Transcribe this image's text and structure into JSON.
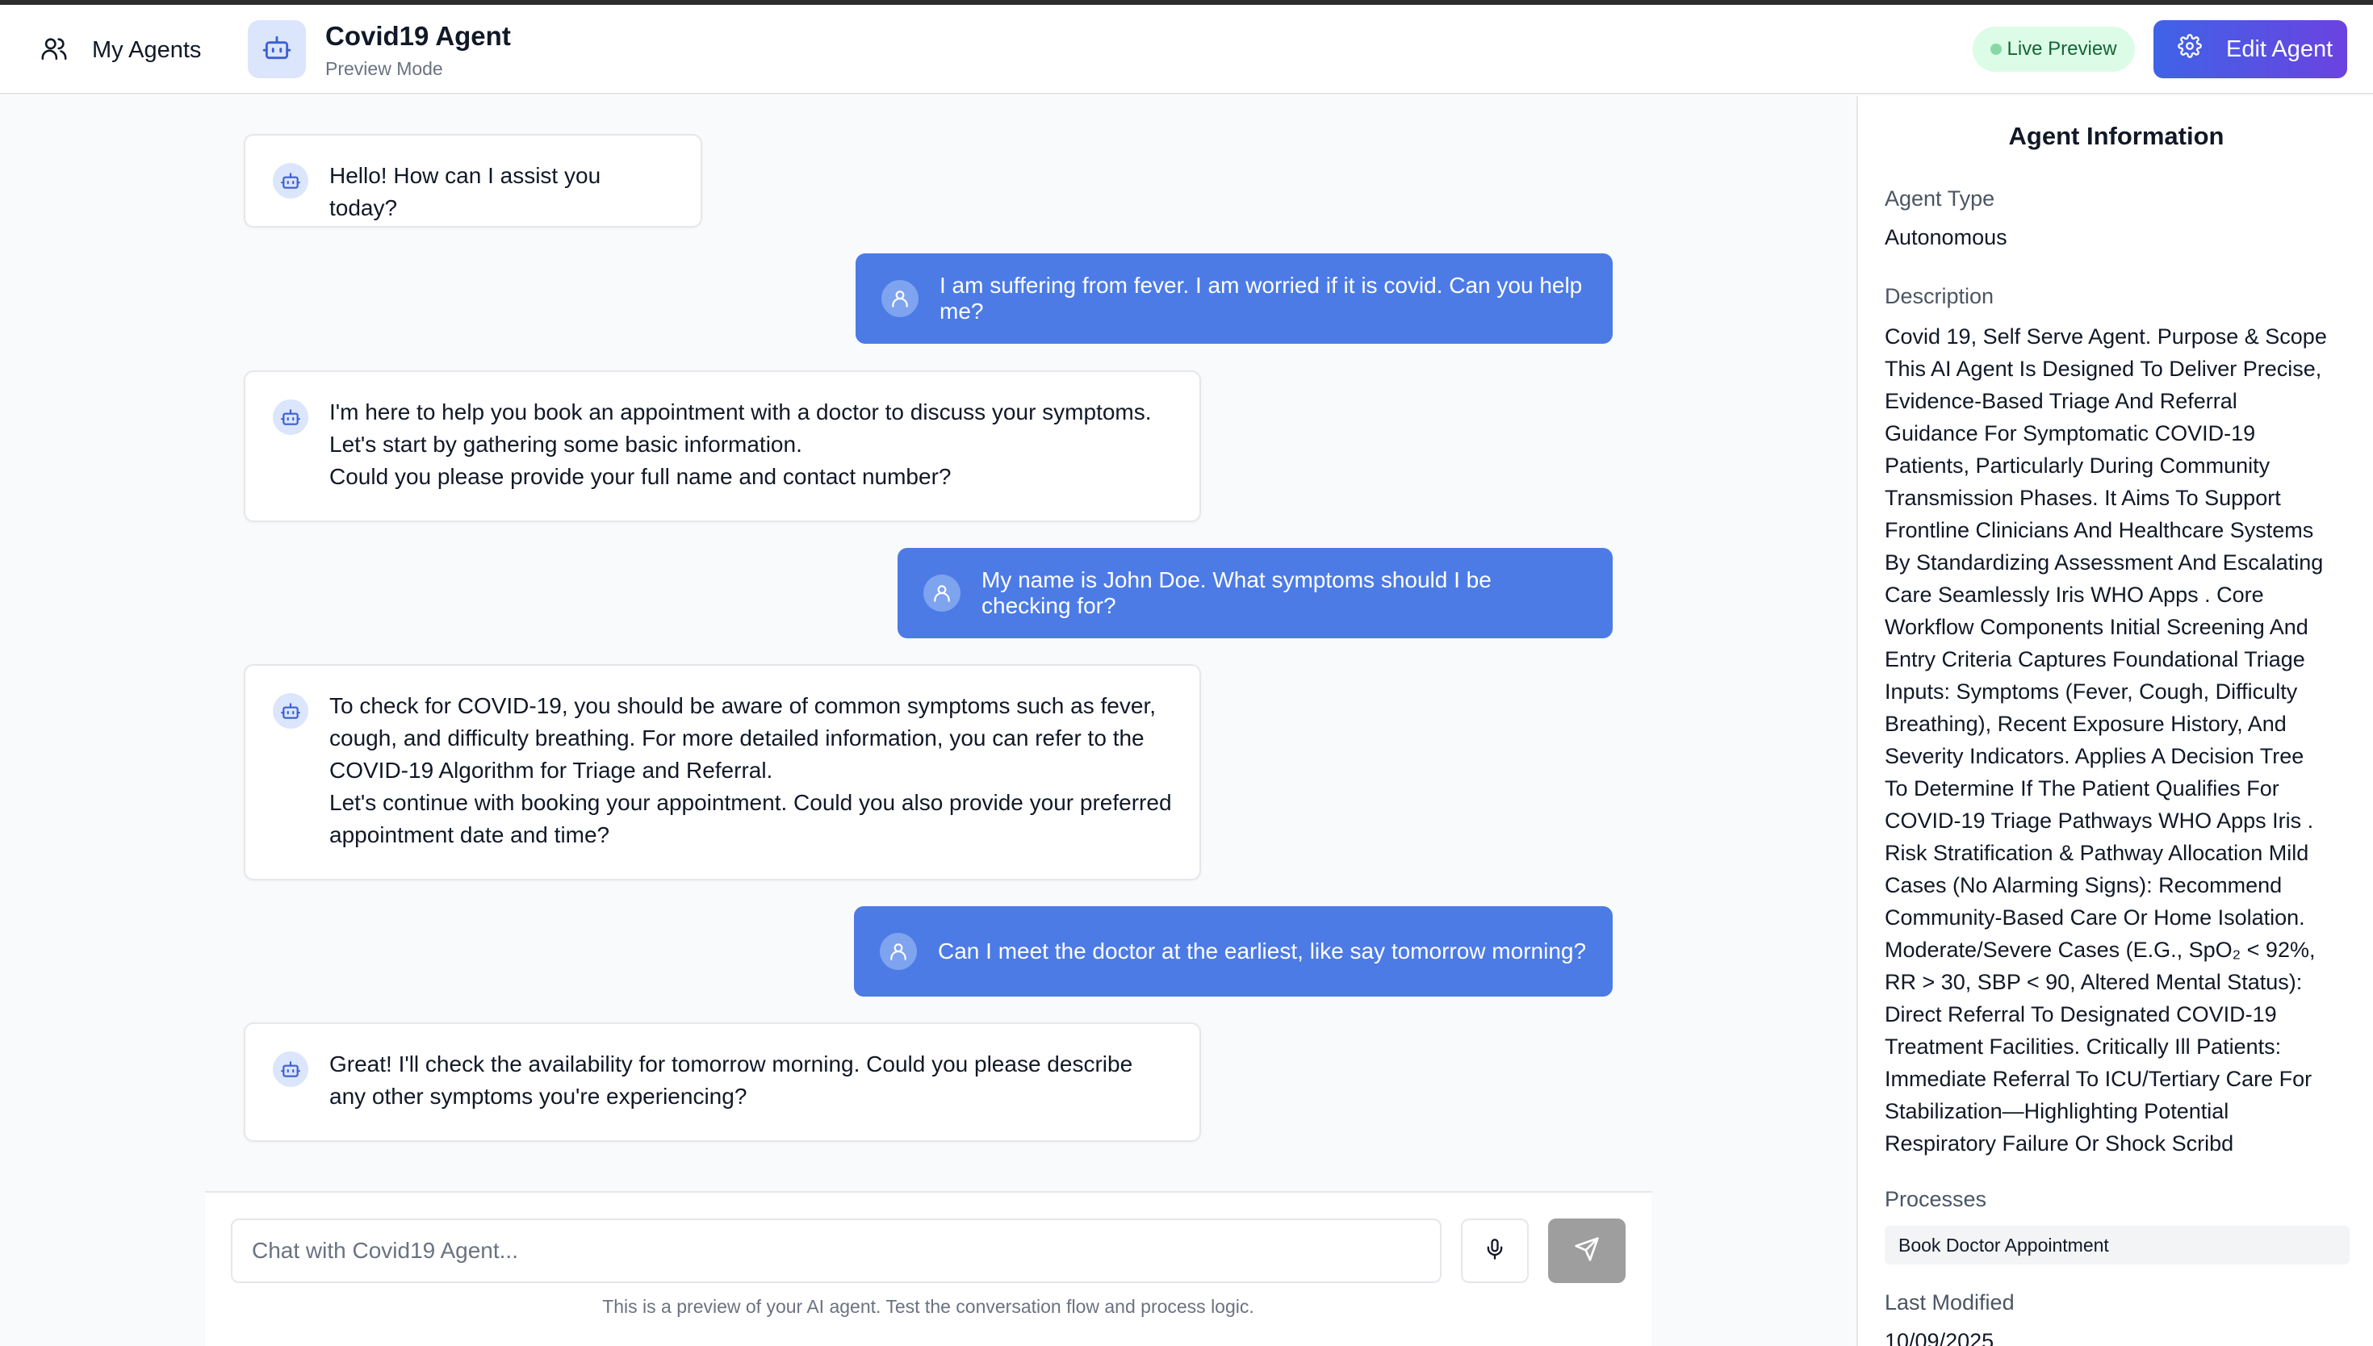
{
  "header": {
    "my_agents_label": "My Agents",
    "agent_name": "Covid19 Agent",
    "mode": "Preview Mode",
    "live_preview": "Live Preview",
    "edit_agent": "Edit Agent"
  },
  "messages": [
    {
      "role": "bot",
      "text": "Hello! How can I assist you today?"
    },
    {
      "role": "user",
      "text": "I am suffering from fever. I am worried if it is covid. Can you help me?"
    },
    {
      "role": "bot",
      "lines": [
        "I'm here to help you book an appointment with a doctor to discuss your symptoms.",
        "Let's start by gathering some basic information.",
        "Could you please provide your full name and contact number?"
      ]
    },
    {
      "role": "user",
      "text": "My name is John Doe. What symptoms should I be checking for?"
    },
    {
      "role": "bot",
      "lines": [
        "To check for COVID-19, you should be aware of common symptoms such as fever,",
        "cough, and difficulty breathing. For more detailed information, you can refer to the",
        "COVID-19 Algorithm for Triage and Referral.",
        "Let's continue with booking your appointment. Could you also provide your preferred",
        "appointment date and time?"
      ]
    },
    {
      "role": "user",
      "text": "Can I meet the doctor at the earliest, like say tomorrow morning?"
    },
    {
      "role": "bot",
      "lines": [
        "Great! I'll check the availability for tomorrow morning. Could you please describe",
        "any other symptoms you're experiencing?"
      ]
    }
  ],
  "chat_input": {
    "placeholder": "Chat with Covid19 Agent...",
    "note": "This is a preview of your AI agent. Test the conversation flow and process logic."
  },
  "panel": {
    "title": "Agent Information",
    "agent_type_label": "Agent Type",
    "agent_type": "Autonomous",
    "description_label": "Description",
    "description_lines": [
      "Covid 19, Self Serve Agent. Purpose & Scope",
      "This AI Agent Is Designed To Deliver Precise,",
      "Evidence-Based Triage And Referral",
      "Guidance For Symptomatic COVID-19",
      "Patients, Particularly During Community",
      "Transmission Phases. It Aims To Support",
      "Frontline Clinicians And Healthcare Systems",
      "By Standardizing Assessment And Escalating",
      "Care Seamlessly Iris WHO Apps . Core",
      "Workflow Components Initial Screening And",
      "Entry Criteria Captures Foundational Triage",
      "Inputs: Symptoms (Fever, Cough, Difficulty",
      "Breathing), Recent Exposure History, And",
      "Severity Indicators. Applies A Decision Tree",
      "To Determine If The Patient Qualifies For",
      "COVID-19 Triage Pathways WHO Apps Iris .",
      "Risk Stratification & Pathway Allocation Mild",
      "Cases (No Alarming Signs): Recommend",
      "Community-Based Care Or Home Isolation.",
      "Moderate/Severe Cases (E.G., SpO₂ < 92%,",
      "RR > 30, SBP < 90, Altered Mental Status):",
      "Direct Referral To Designated COVID-19",
      "Treatment Facilities. Critically Ill Patients:",
      "Immediate Referral To ICU/Tertiary Care For",
      "Stabilization—Highlighting Potential",
      "Respiratory Failure Or Shock Scribd"
    ],
    "processes_label": "Processes",
    "process": "Book Doctor Appointment",
    "last_modified_label": "Last Modified",
    "last_modified": "10/09/2025"
  },
  "colors": {
    "user_bubble": "#4c7be6",
    "accent_start": "#3f63e6",
    "accent_end": "#6b43e0",
    "live_badge_bg": "#dcfce7"
  },
  "icons": {
    "my_agents": "users-icon",
    "agent": "robot-icon",
    "edit": "gear-icon",
    "bot_avatar": "robot-icon",
    "user_avatar": "user-icon",
    "mic": "microphone-icon",
    "send": "send-icon"
  }
}
